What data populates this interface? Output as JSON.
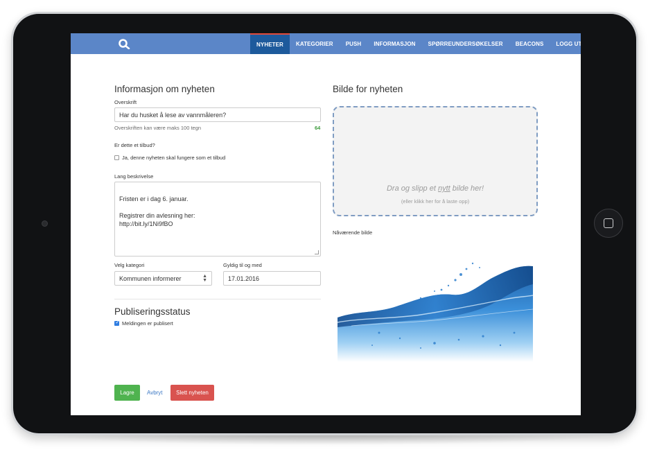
{
  "navbar": {
    "items": [
      {
        "label": "NYHETER",
        "active": true
      },
      {
        "label": "KATEGORIER",
        "active": false
      },
      {
        "label": "PUSH",
        "active": false
      },
      {
        "label": "INFORMASJON",
        "active": false
      },
      {
        "label": "SPØRREUNDERSØKELSER",
        "active": false
      },
      {
        "label": "BEACONS",
        "active": false
      },
      {
        "label": "LOGG UT",
        "active": false
      }
    ]
  },
  "form": {
    "section_title": "Informasjon om nyheten",
    "headline_label": "Overskrift",
    "headline_value": "Har du husket å lese av vannmåleren?",
    "headline_help": "Overskriften kan være maks 100 tegn",
    "headline_counter": "64",
    "offer_question": "Er dette et tilbud?",
    "offer_checkbox_label": "Ja, denne nyheten skal fungere som et tilbud",
    "offer_checked": false,
    "description_label": "Lang beskrivelse",
    "description_value": "Fristen er i dag 6. januar.\n\nRegistrer din avlesning her:\nhttp://bit.ly/1Ni9fBO",
    "category_label": "Velg kategori",
    "category_value": "Kommunen informerer",
    "valid_label": "Gyldig til og med",
    "valid_value": "17.01.2016",
    "publish_title": "Publiseringsstatus",
    "published_label": "Meldingen er publisert",
    "published_checked": true
  },
  "image": {
    "section_title": "Bilde for nyheten",
    "dropzone_text_before": "Dra og slipp et ",
    "dropzone_text_link": "nytt",
    "dropzone_text_after": " bilde her!",
    "dropzone_subtext": "(eller klikk her for å laste opp)",
    "current_label": "Nåværende bilde"
  },
  "actions": {
    "save_label": "Lagre",
    "cancel_label": "Avbryt",
    "delete_label": "Slett nyheten"
  },
  "colors": {
    "navbar": "#5b86c8",
    "nav_active": "#1d5a9c",
    "save": "#4fb34f",
    "delete": "#d9534f",
    "link": "#3b78c4"
  },
  "icons": {
    "logo": "search-logo-icon",
    "select_arrows": "updown-arrows-icon"
  }
}
